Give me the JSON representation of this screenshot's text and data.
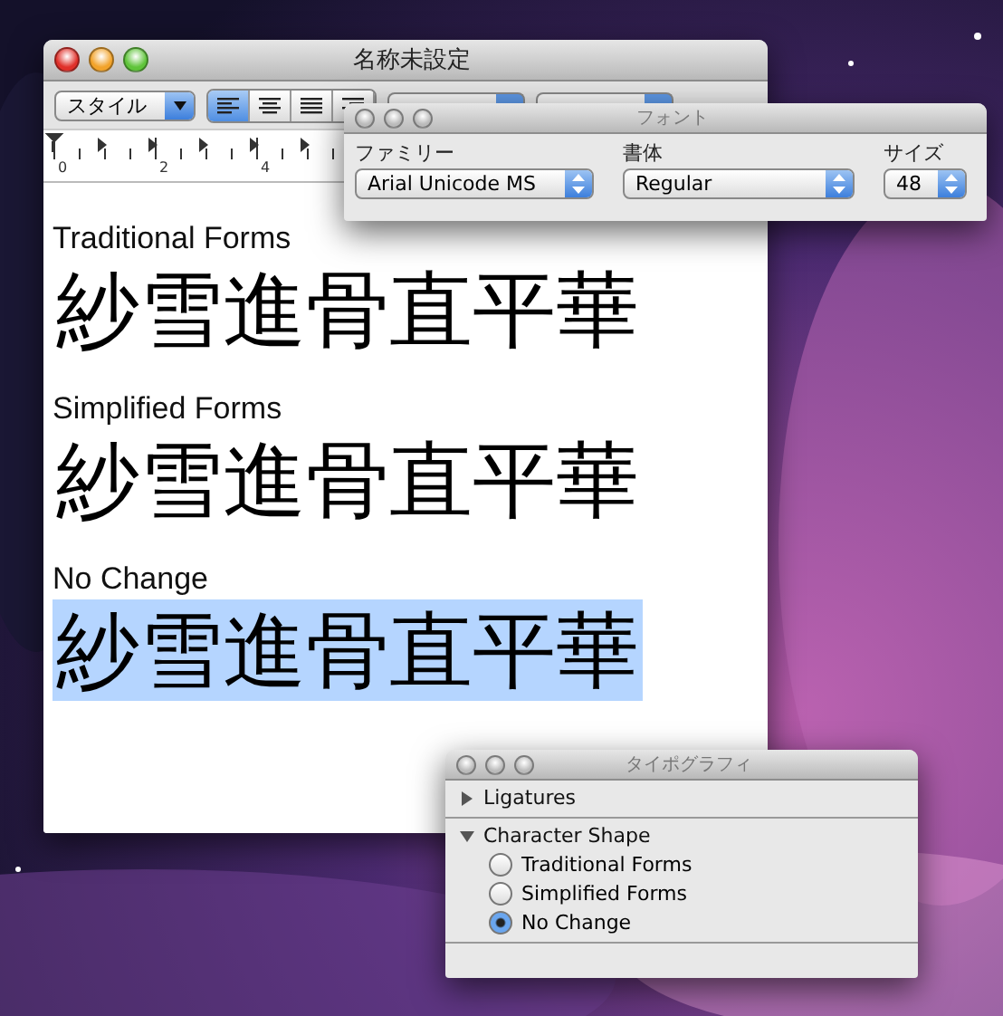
{
  "main_window": {
    "title": "名称未設定",
    "toolbar": {
      "style_popup": "スタイル",
      "alignment": [
        {
          "kind": "left",
          "selected": true
        },
        {
          "kind": "center",
          "selected": false
        },
        {
          "kind": "justify",
          "selected": false
        },
        {
          "kind": "right",
          "selected": false
        }
      ]
    },
    "ruler": {
      "labels": [
        "0",
        "2",
        "4"
      ]
    },
    "document": {
      "blocks": [
        {
          "heading": "Traditional Forms",
          "sample": "紗雪進骨直平華",
          "selected": false
        },
        {
          "heading": "Simplified Forms",
          "sample": "紗雪進骨直平華",
          "selected": false
        },
        {
          "heading": "No Change",
          "sample": "紗雪進骨直平華",
          "selected": true
        }
      ]
    }
  },
  "font_panel": {
    "title": "フォント",
    "fields": [
      {
        "label": "ファミリー",
        "value": "Arial Unicode MS"
      },
      {
        "label": "書体",
        "value": "Regular"
      },
      {
        "label": "サイズ",
        "value": "48"
      }
    ]
  },
  "typography_panel": {
    "title": "タイポグラフィ",
    "sections": [
      {
        "label": "Ligatures",
        "expanded": false
      },
      {
        "label": "Character Shape",
        "expanded": true,
        "options": [
          {
            "label": "Traditional Forms",
            "selected": false
          },
          {
            "label": "Simplified Forms",
            "selected": false
          },
          {
            "label": "No Change",
            "selected": true
          }
        ]
      }
    ]
  }
}
